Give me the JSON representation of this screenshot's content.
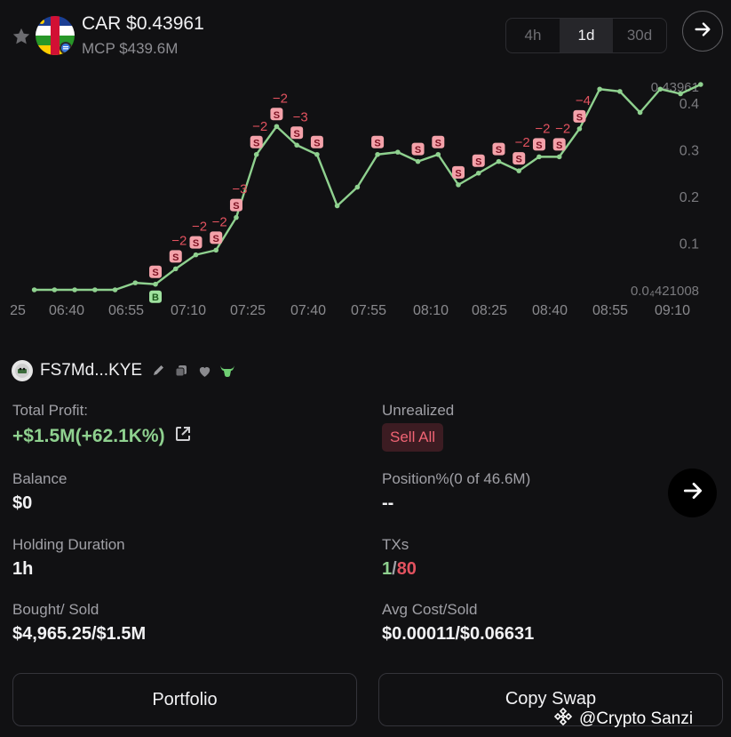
{
  "header": {
    "title": "CAR $0.43961",
    "mcp": "MCP $439.6M",
    "timeframes": [
      "4h",
      "1d",
      "30d"
    ],
    "active_timeframe": "1d"
  },
  "chart_data": {
    "type": "line",
    "price_label_top": "0.43961",
    "price_label_bottom": "0.0₄421008",
    "y_ticks": [
      "0.4",
      "0.3",
      "0.2",
      "0.1"
    ],
    "x_ticks": [
      "25",
      "06:40",
      "06:55",
      "07:10",
      "07:25",
      "07:40",
      "07:55",
      "08:10",
      "08:25",
      "08:40",
      "08:55",
      "09:10"
    ],
    "y_range": [
      0.0,
      0.44
    ],
    "line_color": "#8fd18f",
    "x": [
      "06:32",
      "06:37",
      "06:42",
      "06:47",
      "06:52",
      "06:57",
      "07:02",
      "07:07",
      "07:12",
      "07:17",
      "07:22",
      "07:27",
      "07:32",
      "07:37",
      "07:42",
      "07:47",
      "07:52",
      "07:57",
      "08:02",
      "08:07",
      "08:12",
      "08:17",
      "08:22",
      "08:27",
      "08:32",
      "08:37",
      "08:42",
      "08:47",
      "08:52",
      "08:57",
      "09:02",
      "09:07",
      "09:12",
      "09:17"
    ],
    "y": [
      0.0,
      0.0,
      0.0,
      0.0,
      0.0,
      0.015,
      0.012,
      0.045,
      0.075,
      0.085,
      0.155,
      0.29,
      0.35,
      0.31,
      0.29,
      0.18,
      0.22,
      0.29,
      0.295,
      0.275,
      0.29,
      0.225,
      0.25,
      0.275,
      0.255,
      0.285,
      0.285,
      0.345,
      0.43,
      0.425,
      0.38,
      0.43,
      0.42,
      0.44
    ],
    "buy_markers": [
      {
        "index": 6,
        "label": "B"
      }
    ],
    "sell_markers": [
      {
        "index": 6,
        "label": "S",
        "annot": ""
      },
      {
        "index": 7,
        "label": "S",
        "annot": "−2"
      },
      {
        "index": 8,
        "label": "S",
        "annot": "−2"
      },
      {
        "index": 9,
        "label": "S",
        "annot": "−2"
      },
      {
        "index": 10,
        "label": "S",
        "annot": "−3"
      },
      {
        "index": 11,
        "label": "S",
        "annot": "−2"
      },
      {
        "index": 12,
        "label": "S",
        "annot": "−2"
      },
      {
        "index": 13,
        "label": "S",
        "annot": "−3"
      },
      {
        "index": 14,
        "label": "S",
        "annot": ""
      },
      {
        "index": 17,
        "label": "S",
        "annot": ""
      },
      {
        "index": 19,
        "label": "S",
        "annot": ""
      },
      {
        "index": 20,
        "label": "S",
        "annot": ""
      },
      {
        "index": 21,
        "label": "S",
        "annot": ""
      },
      {
        "index": 22,
        "label": "S",
        "annot": ""
      },
      {
        "index": 23,
        "label": "S",
        "annot": ""
      },
      {
        "index": 24,
        "label": "S",
        "annot": "−2"
      },
      {
        "index": 25,
        "label": "S",
        "annot": "−2"
      },
      {
        "index": 26,
        "label": "S",
        "annot": "−2"
      },
      {
        "index": 27,
        "label": "S",
        "annot": "−4"
      }
    ]
  },
  "wallet": {
    "name": "FS7Md...KYE"
  },
  "stats": {
    "total_profit_label": "Total Profit:",
    "total_profit_value": "+$1.5M(+62.1K%)",
    "unrealized_label": "Unrealized",
    "sell_all_label": "Sell All",
    "balance_label": "Balance",
    "balance_value": "$0",
    "position_label": "Position%(0 of 46.6M)",
    "position_value": "--",
    "holding_label": "Holding Duration",
    "holding_value": "1h",
    "txs_label": "TXs",
    "txs_buys": "1",
    "txs_sep": "/",
    "txs_sells": "80",
    "bought_sold_label": "Bought/ Sold",
    "bought_sold_value": "$4,965.25/$1.5M",
    "avg_cost_label": "Avg Cost/Sold",
    "avg_cost_value": "$0.00011/$0.06631"
  },
  "footer": {
    "portfolio_label": "Portfolio",
    "copy_swap_label": "Copy Swap",
    "watermark": "@Crypto Sanzi"
  },
  "colors": {
    "background": "#111113",
    "profit_green": "#8fd18f",
    "sell_red": "#e2525f"
  },
  "icons": [
    "star-icon",
    "token-logo",
    "arrow-right-icon",
    "edit-icon",
    "copy-icon",
    "heart-icon",
    "bull-icon",
    "external-link-icon",
    "binance-icon"
  ]
}
